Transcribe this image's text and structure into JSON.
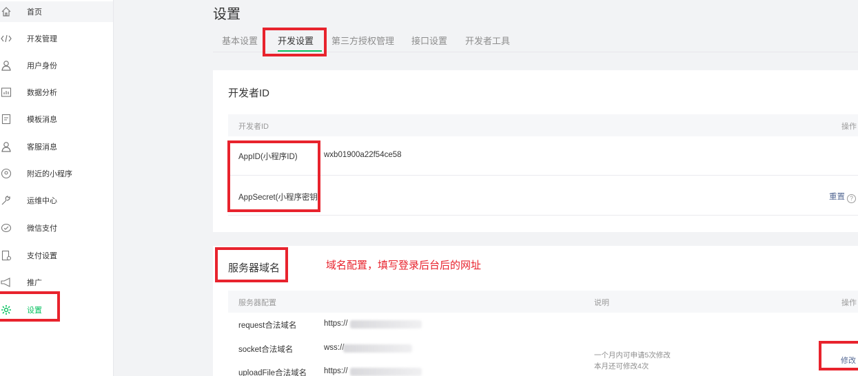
{
  "sidebar": {
    "items": [
      {
        "label": "首页",
        "icon": "home-icon"
      },
      {
        "label": "开发管理",
        "icon": "code-icon"
      },
      {
        "label": "用户身份",
        "icon": "user-icon"
      },
      {
        "label": "数据分析",
        "icon": "chart-icon"
      },
      {
        "label": "模板消息",
        "icon": "document-icon"
      },
      {
        "label": "客服消息",
        "icon": "service-icon"
      },
      {
        "label": "附近的小程序",
        "icon": "location-icon"
      },
      {
        "label": "运维中心",
        "icon": "wrench-icon"
      },
      {
        "label": "微信支付",
        "icon": "chat-icon"
      },
      {
        "label": "支付设置",
        "icon": "payment-settings-icon"
      },
      {
        "label": "推广",
        "icon": "megaphone-icon"
      },
      {
        "label": "设置",
        "icon": "gear-icon"
      }
    ],
    "active_color": "#07c160"
  },
  "page": {
    "title": "设置"
  },
  "tabs": [
    "基本设置",
    "开发设置",
    "第三方授权管理",
    "接口设置",
    "开发者工具"
  ],
  "developer_id": {
    "section_title": "开发者ID",
    "col_id": "开发者ID",
    "col_action": "操作",
    "appid_label": "AppID(小程序ID)",
    "appid_value": "wxb01900a22f54ce58",
    "secret_label": "AppSecret(小程序密钥)",
    "reset_label": "重置",
    "help_glyph": "?"
  },
  "server": {
    "section_title": "服务器域名",
    "annotation": "域名配置，填写登录后台后的网址",
    "col_config": "服务器配置",
    "col_desc": "说明",
    "col_action": "操作",
    "rows": [
      {
        "label": "request合法域名",
        "value": "https://"
      },
      {
        "label": "socket合法域名",
        "value": "wss://"
      },
      {
        "label": "uploadFile合法域名",
        "value": "https://"
      }
    ],
    "desc_line1": "一个月内可申请5次修改",
    "desc_line2": "本月还可修改4次",
    "modify_label": "修改"
  },
  "colors": {
    "highlight": "#e8232d",
    "link": "#576b95",
    "accent": "#07c160"
  }
}
